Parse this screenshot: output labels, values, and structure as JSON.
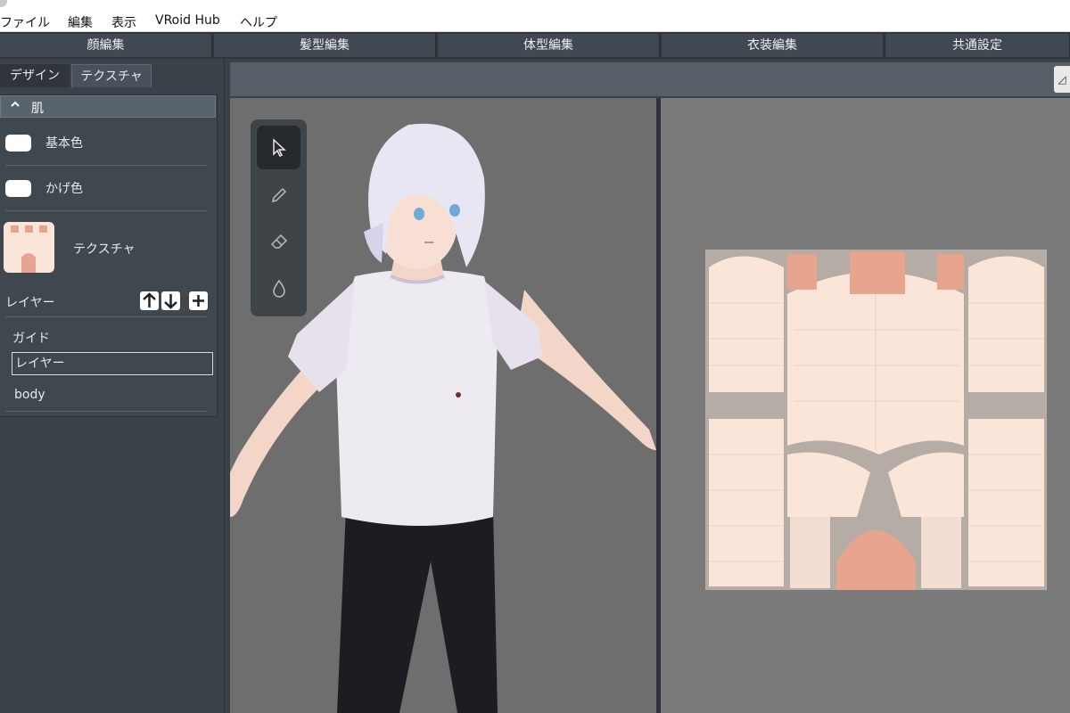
{
  "menu": [
    "ファイル",
    "編集",
    "表示",
    "VRoid Hub",
    "ヘルプ"
  ],
  "editor_tabs": [
    "顔編集",
    "髪型編集",
    "体型編集",
    "衣装編集",
    "共通設定"
  ],
  "sub_tabs": {
    "design": "デザイン",
    "texture": "テクスチャ"
  },
  "skin_section": {
    "title": "肌",
    "base_color_label": "基本色",
    "shadow_color_label": "かげ色",
    "texture_label": "テクスチャ"
  },
  "layers": {
    "label": "レイヤー",
    "items": [
      "ガイド",
      "レイヤー",
      "body"
    ]
  },
  "tools": [
    "select-tool",
    "pen-tool",
    "eraser-tool",
    "fill-tool"
  ],
  "colors": {
    "skin": "#fbe5d9",
    "skin_dark": "#e7a58e",
    "panel": "#3a4148",
    "viewport": "#6e6e6e"
  }
}
